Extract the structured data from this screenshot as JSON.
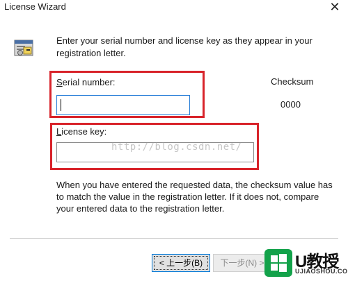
{
  "window": {
    "title": "License Wizard",
    "close_glyph": "✕"
  },
  "intro_text": "Enter your serial number and license key as they appear in your registration letter.",
  "serial": {
    "label_accel": "S",
    "label_rest": "erial number:",
    "value": ""
  },
  "license": {
    "label_accel": "L",
    "label_rest": "icense key:",
    "value": ""
  },
  "checksum": {
    "label": "Checksum",
    "value": "0000"
  },
  "watermark": {
    "url": "http://blog.csdn.net/"
  },
  "info_text": "When you have entered the requested data, the checksum value has to match the value in the registration letter.  If it does not, compare your entered data to the registration letter.",
  "buttons": {
    "back_label": "< 上一步(B)",
    "next_label": "下一步(N) >"
  },
  "logo": {
    "text": "U教授",
    "sub": "UJIAOSHOU.COM",
    "icon": "windows-logo-icon"
  },
  "colors": {
    "highlight_box": "#d8232a",
    "focus_border": "#2a7fd8",
    "logo_green": "#13a24a"
  }
}
